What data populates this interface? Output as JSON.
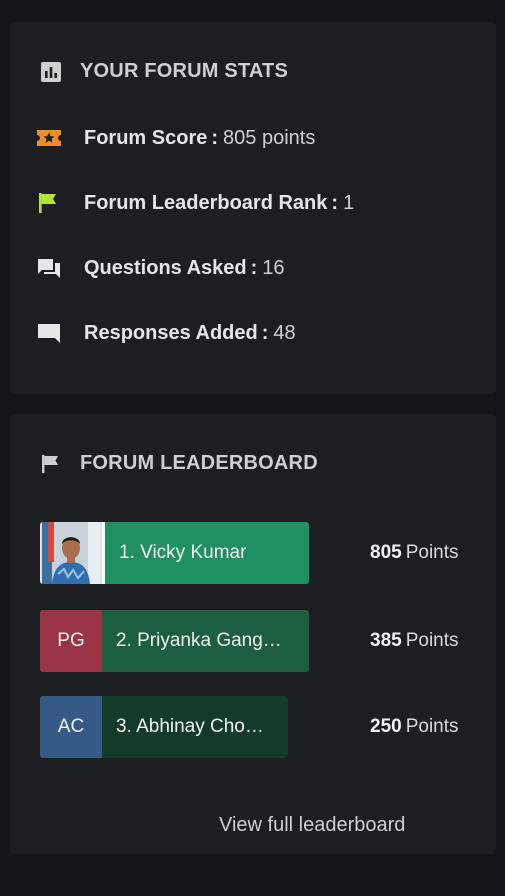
{
  "stats": {
    "title": "YOUR FORUM STATS",
    "rows": [
      {
        "label": "Forum Score",
        "sep": ":",
        "value": "805 points",
        "icon": "ticket-star-icon",
        "color": "#f08c2a"
      },
      {
        "label": "Forum Leaderboard Rank",
        "sep": ":",
        "value": "1",
        "icon": "flag-icon",
        "color": "#b4e33a"
      },
      {
        "label": "Questions Asked",
        "sep": ":",
        "value": "16",
        "icon": "forum-icon",
        "color": "#e6e6e6"
      },
      {
        "label": "Responses Added",
        "sep": ":",
        "value": "48",
        "icon": "comment-icon",
        "color": "#e6e6e6"
      }
    ]
  },
  "leaderboard": {
    "title": "FORUM LEADERBOARD",
    "entries": [
      {
        "rank_name": "1. Vicky Kumar",
        "avatar": "",
        "avatar_color": "#6b8fb0",
        "bar_color": "#1f9060",
        "points": "805",
        "unit": "Points"
      },
      {
        "rank_name": "2. Priyanka Gang…",
        "avatar": "PG",
        "avatar_color": "#9b3447",
        "bar_color": "#1b5f3e",
        "points": "385",
        "unit": "Points"
      },
      {
        "rank_name": "3. Abhinay Cho…",
        "avatar": "AC",
        "avatar_color": "#355a85",
        "bar_color": "#133b28",
        "points": "250",
        "unit": "Points"
      }
    ],
    "view_all": "View full leaderboard"
  }
}
